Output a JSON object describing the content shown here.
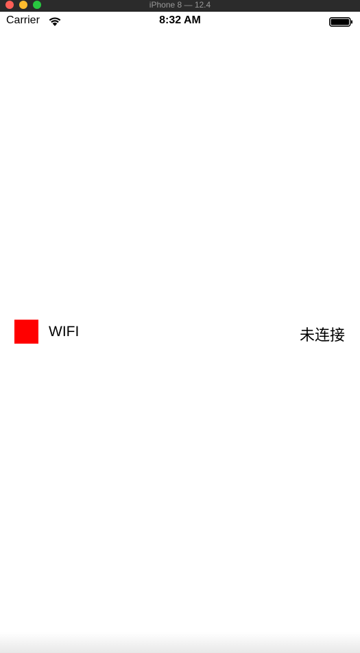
{
  "window": {
    "title": "iPhone 8 — 12.4"
  },
  "status_bar": {
    "carrier": "Carrier",
    "time": "8:32 AM",
    "wifi_icon": "wifi-icon",
    "battery_icon": "battery-icon"
  },
  "wifi_row": {
    "label": "WIFI",
    "status": "未连接",
    "indicator_color": "#ff0000",
    "indicator_icon": "red-square-indicator"
  }
}
